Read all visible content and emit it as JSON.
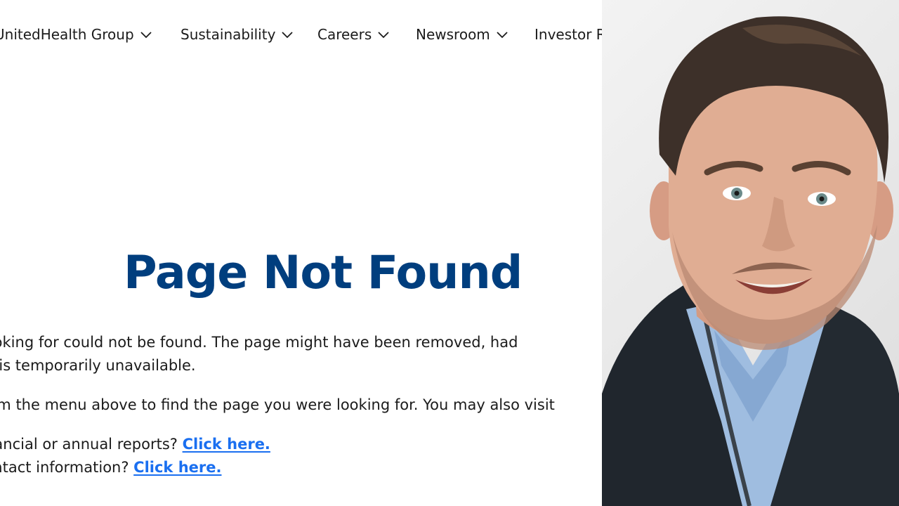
{
  "nav": {
    "items": [
      {
        "label": "UnitedHealth Group"
      },
      {
        "label": "Sustainability"
      },
      {
        "label": "Careers"
      },
      {
        "label": "Newsroom"
      },
      {
        "label": "Investor R"
      }
    ],
    "chevron_icon": "chevron-down-icon"
  },
  "main": {
    "title": "Page Not Found",
    "paragraph1_line1": "The page you're looking for could not be found. The page might have been removed, had",
    "paragraph1_line2": "its name changed or is temporarily unavailable.",
    "paragraph2": "Please select from the menu above to find the page you were looking for. You may also visit",
    "paragraph3_text": "Looking for financial or annual reports? ",
    "paragraph3_link": "Click here.",
    "paragraph4_text": "Looking for contact information? ",
    "paragraph4_link": "Click here."
  },
  "colors": {
    "title": "#003e7e",
    "link": "#1a6ff0",
    "text": "#1b1b1b"
  }
}
